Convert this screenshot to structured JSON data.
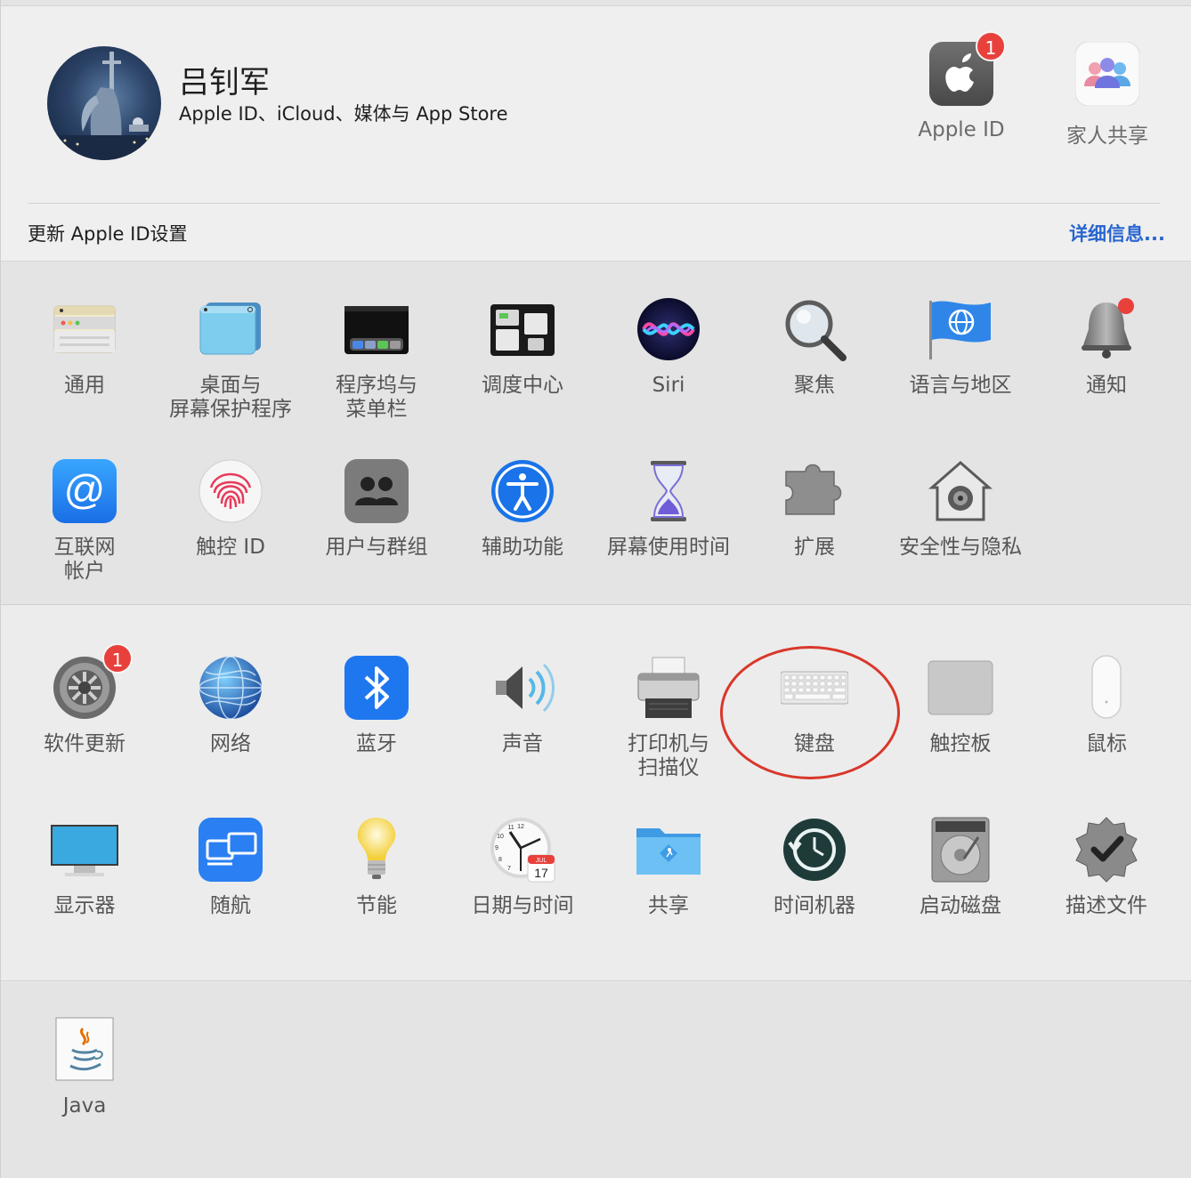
{
  "account": {
    "name": "吕钊军",
    "subtitle": "Apple ID、iCloud、媒体与 App Store",
    "apple_id_label": "Apple ID",
    "apple_id_badge": "1",
    "family_label": "家人共享",
    "update_text": "更新 Apple ID设置",
    "details_link": "详细信息..."
  },
  "section1": [
    {
      "label": "通用",
      "icon": "general-icon"
    },
    {
      "label": "桌面与\n屏幕保护程序",
      "icon": "desktop-icon"
    },
    {
      "label": "程序坞与\n菜单栏",
      "icon": "dock-icon"
    },
    {
      "label": "调度中心",
      "icon": "mission-control-icon"
    },
    {
      "label": "Siri",
      "icon": "siri-icon"
    },
    {
      "label": "聚焦",
      "icon": "spotlight-icon"
    },
    {
      "label": "语言与地区",
      "icon": "language-flag-icon"
    },
    {
      "label": "通知",
      "icon": "bell-icon"
    },
    {
      "label": "互联网\n帐户",
      "icon": "at-sign-icon"
    },
    {
      "label": "触控 ID",
      "icon": "fingerprint-icon"
    },
    {
      "label": "用户与群组",
      "icon": "users-icon"
    },
    {
      "label": "辅助功能",
      "icon": "accessibility-icon"
    },
    {
      "label": "屏幕使用时间",
      "icon": "hourglass-icon"
    },
    {
      "label": "扩展",
      "icon": "puzzle-icon"
    },
    {
      "label": "安全性与隐私",
      "icon": "house-lock-icon"
    }
  ],
  "section2": [
    {
      "label": "软件更新",
      "icon": "gear-icon",
      "badge": "1"
    },
    {
      "label": "网络",
      "icon": "globe-icon"
    },
    {
      "label": "蓝牙",
      "icon": "bluetooth-icon"
    },
    {
      "label": "声音",
      "icon": "speaker-icon"
    },
    {
      "label": "打印机与\n扫描仪",
      "icon": "printer-icon"
    },
    {
      "label": "键盘",
      "icon": "keyboard-icon"
    },
    {
      "label": "触控板",
      "icon": "trackpad-icon"
    },
    {
      "label": "鼠标",
      "icon": "mouse-icon"
    },
    {
      "label": "显示器",
      "icon": "display-icon"
    },
    {
      "label": "随航",
      "icon": "sidecar-icon"
    },
    {
      "label": "节能",
      "icon": "lightbulb-icon"
    },
    {
      "label": "日期与时间",
      "icon": "clock-icon",
      "calendar_month": "JUL",
      "calendar_day": "17"
    },
    {
      "label": "共享",
      "icon": "folder-share-icon"
    },
    {
      "label": "时间机器",
      "icon": "time-machine-icon"
    },
    {
      "label": "启动磁盘",
      "icon": "hard-disk-icon"
    },
    {
      "label": "描述文件",
      "icon": "check-badge-icon"
    }
  ],
  "section3": [
    {
      "label": "Java",
      "icon": "java-icon"
    }
  ],
  "colors": {
    "badge": "#e8413c",
    "link": "#2a66cf",
    "highlight_ring": "#d9372b"
  }
}
